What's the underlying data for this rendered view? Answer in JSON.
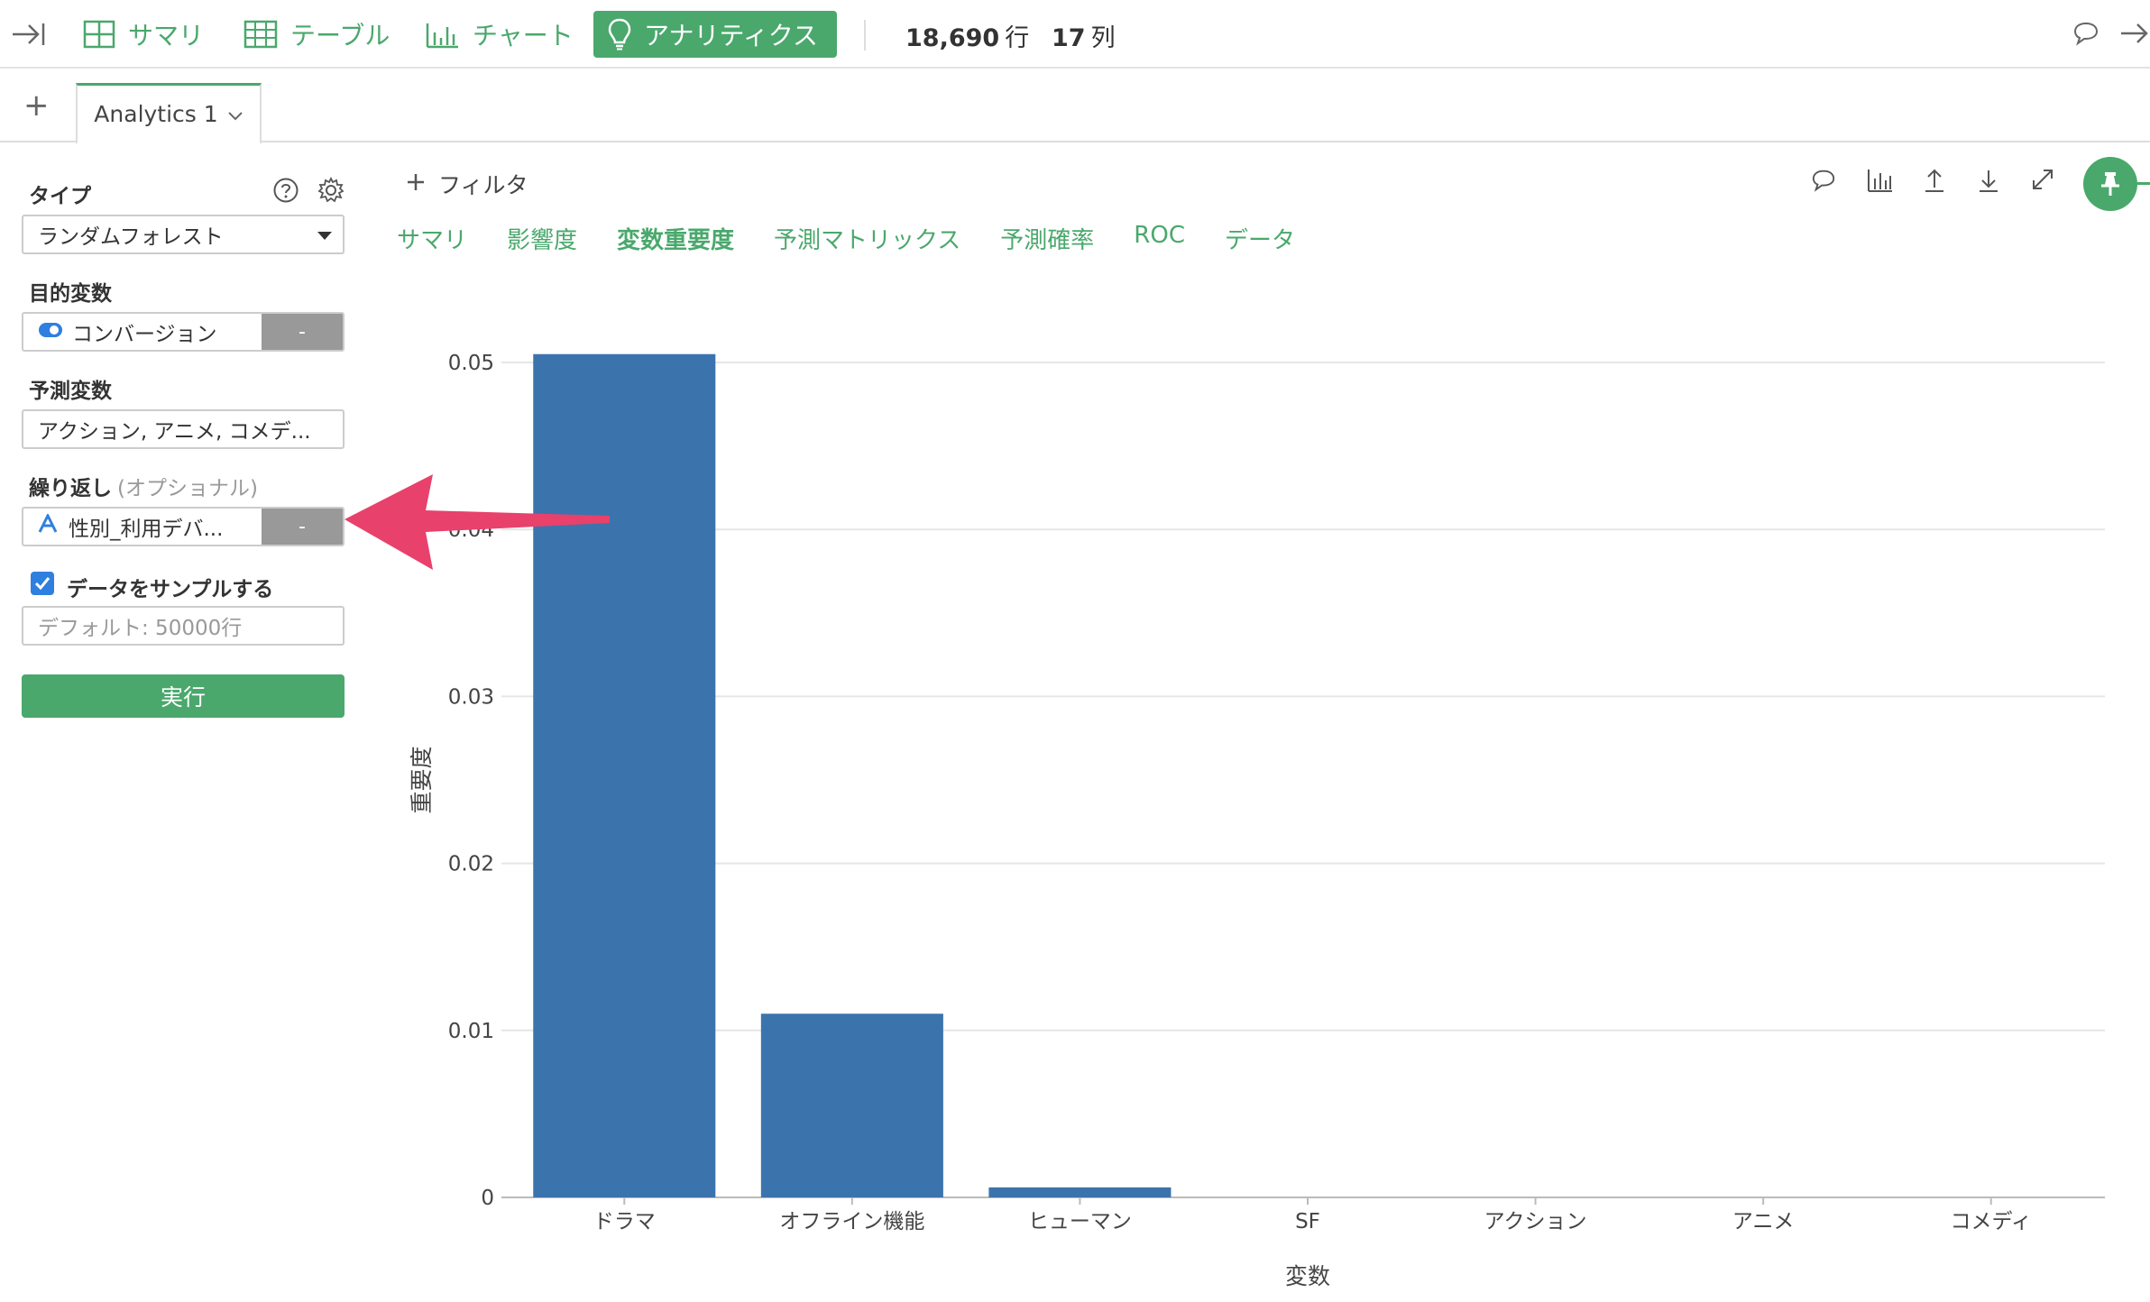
{
  "topbar": {
    "summary": "サマリ",
    "table": "テーブル",
    "chart": "チャート",
    "analytics": "アナリティクス",
    "rows_count": "18,690",
    "rows_unit": "行",
    "cols_count": "17",
    "cols_unit": "列"
  },
  "tabs": {
    "add": "+",
    "active_label": "Analytics 1"
  },
  "panel": {
    "type_label": "タイプ",
    "type_value": "ランダムフォレスト",
    "target_label": "目的変数",
    "target_value": "コンバージョン",
    "target_minus": "-",
    "predictors_label": "予測変数",
    "predictors_value": "アクション, アニメ, コメデ...",
    "repeat_label": "繰り返し",
    "repeat_optional": "(オプショナル)",
    "repeat_value": "性別_利用デバ...",
    "repeat_minus": "-",
    "sample_label": "データをサンプルする",
    "sample_checked": true,
    "sample_placeholder": "デフォルト: 50000行",
    "run_label": "実行"
  },
  "main": {
    "filter_label": "フィルタ",
    "subtabs": [
      "サマリ",
      "影響度",
      "変数重要度",
      "予測マトリックス",
      "予測確率",
      "ROC",
      "データ"
    ],
    "active_subtab": "変数重要度"
  },
  "colors": {
    "accent": "#4aa86c",
    "bar": "#3b73ad",
    "arrow": "#e8416b"
  },
  "chart_data": {
    "type": "bar",
    "categories": [
      "ドラマ",
      "オフライン機能",
      "ヒューマン",
      "SF",
      "アクション",
      "アニメ",
      "コメディ"
    ],
    "values": [
      0.0505,
      0.011,
      0.0006,
      0,
      0,
      0,
      0
    ],
    "xlabel": "変数",
    "ylabel": "重要度",
    "ylim": [
      0,
      0.05
    ],
    "yticks": [
      "0",
      "0.01",
      "0.02",
      "0.03",
      "0.04",
      "0.05"
    ],
    "grid": true
  }
}
